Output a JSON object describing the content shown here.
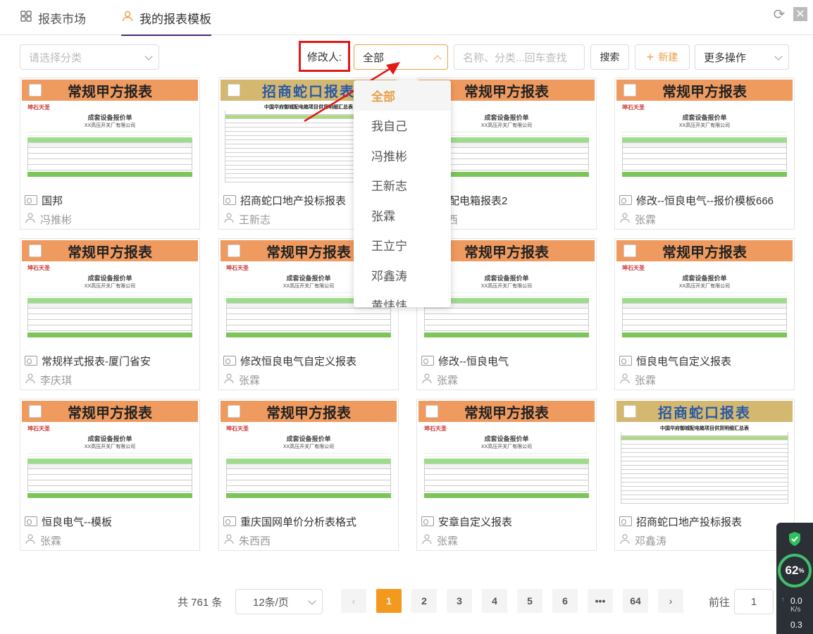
{
  "tabs": [
    {
      "label": "报表市场"
    },
    {
      "label": "我的报表模板"
    }
  ],
  "toolbar": {
    "category_placeholder": "请选择分类",
    "modifier_label": "修改人:",
    "modifier_value": "全部",
    "search_placeholder": "名称、分类...回车查找",
    "search_button": "搜索",
    "new_button": "新建",
    "more_button": "更多操作"
  },
  "dropdown": {
    "items": [
      "全部",
      "我自己",
      "冯推彬",
      "王新志",
      "张霖",
      "王立宁",
      "邓鑫涛",
      "黄炜炜"
    ]
  },
  "thumbs": {
    "regular_title": "常规甲方报表",
    "merchants_title": "招商蛇口报表",
    "doc_title": "成套设备报价单",
    "doc_company": "XX高压开关厂有限公司",
    "doc_logo": "坤石天圣",
    "merchants_doc_title": "中国华府御城配电箱项目供货明细汇总表"
  },
  "cards": [
    {
      "name": "国邦",
      "user": "冯推彬"
    },
    {
      "name": "招商蛇口地产投标报表",
      "user": "王新志"
    },
    {
      "name": "亿配电箱报表2",
      "user": "西西"
    },
    {
      "name": "修改--恒良电气--报价模板666",
      "user": "张霖"
    },
    {
      "name": "常规样式报表-厦门省安",
      "user": "李庆琪"
    },
    {
      "name": "修改恒良电气自定义报表",
      "user": "张霖"
    },
    {
      "name": "修改--恒良电气",
      "user": "张霖"
    },
    {
      "name": "恒良电气自定义报表",
      "user": "张霖"
    },
    {
      "name": "恒良电气--模板",
      "user": "张霖"
    },
    {
      "name": "重庆国网单价分析表格式",
      "user": "朱西西"
    },
    {
      "name": "安章自定义报表",
      "user": "张霖"
    },
    {
      "name": "招商蛇口地产投标报表",
      "user": "邓鑫涛"
    }
  ],
  "pagination": {
    "total": "共 761 条",
    "page_size": "12条/页",
    "pages": [
      "1",
      "2",
      "3",
      "4",
      "5",
      "6",
      "•••",
      "64"
    ],
    "current": "1",
    "goto_label": "前往",
    "goto_value": "1"
  },
  "widget": {
    "percent": "62",
    "percent_unit": "%",
    "upload": "0.0",
    "unit": "K/s",
    "download": "0.3"
  },
  "colors": {
    "accent": "#e8a04a",
    "active_page": "#f39a1e",
    "highlight_box": "#e01919",
    "tab_underline": "#4b2a7a"
  }
}
